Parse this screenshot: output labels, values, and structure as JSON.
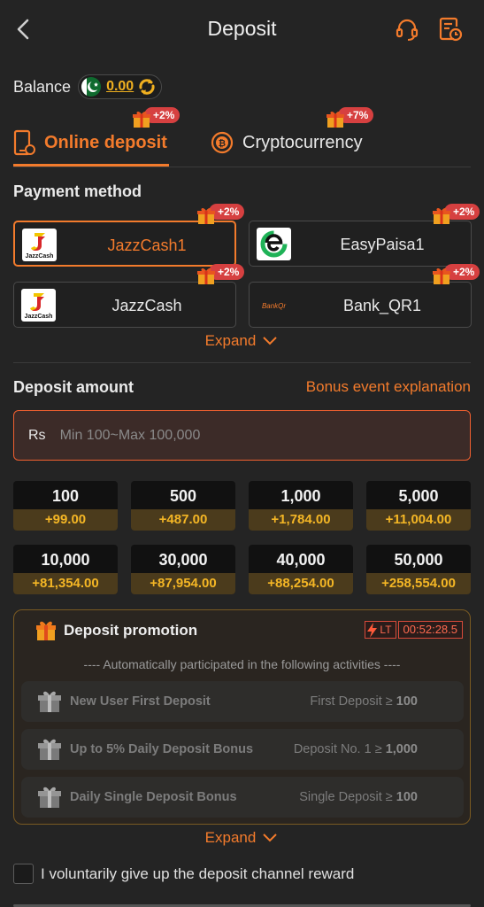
{
  "header": {
    "title": "Deposit",
    "back_icon": "chevron-left-icon",
    "support_icon": "headset-icon",
    "history_icon": "history-icon"
  },
  "balance": {
    "label": "Balance",
    "value": "0.00",
    "flag_icon": "pakistan-flag-icon",
    "refresh_icon": "refresh-icon"
  },
  "tabs": [
    {
      "label": "Online deposit",
      "badge": "+2%",
      "active": true
    },
    {
      "label": "Cryptocurrency",
      "badge": "+7%",
      "active": false
    }
  ],
  "payment": {
    "title": "Payment method",
    "methods": [
      {
        "name": "JazzCash1",
        "badge": "+2%",
        "logo": "JazzCash",
        "selected": true
      },
      {
        "name": "EasyPaisa1",
        "badge": "+2%",
        "logo": "",
        "selected": false
      },
      {
        "name": "JazzCash",
        "badge": "+2%",
        "logo": "JazzCash",
        "selected": false
      },
      {
        "name": "Bank_QR1",
        "badge": "+2%",
        "logo": "BankQr",
        "selected": false
      }
    ],
    "expand_label": "Expand"
  },
  "amount": {
    "title": "Deposit amount",
    "bonus_link": "Bonus event explanation",
    "currency": "Rs",
    "placeholder": "Min 100~Max 100,000",
    "chips": [
      {
        "value": "100",
        "bonus": "+99.00"
      },
      {
        "value": "500",
        "bonus": "+487.00"
      },
      {
        "value": "1,000",
        "bonus": "+1,784.00"
      },
      {
        "value": "5,000",
        "bonus": "+11,004.00"
      },
      {
        "value": "10,000",
        "bonus": "+81,354.00"
      },
      {
        "value": "30,000",
        "bonus": "+87,954.00"
      },
      {
        "value": "40,000",
        "bonus": "+88,254.00"
      },
      {
        "value": "50,000",
        "bonus": "+258,554.00"
      }
    ]
  },
  "promotion": {
    "title": "Deposit promotion",
    "timer_label": "LT",
    "timer": "00:52:28.5",
    "subtitle": "---- Automatically participated in the following activities ----",
    "activities": [
      {
        "name": "New User First Deposit",
        "condition": "First Deposit ≥",
        "amount": "100"
      },
      {
        "name": "Up to 5% Daily Deposit Bonus",
        "condition": "Deposit No. 1 ≥",
        "amount": "1,000"
      },
      {
        "name": "Daily Single Deposit Bonus",
        "condition": "Single Deposit ≥",
        "amount": "100"
      }
    ],
    "expand_label": "Expand"
  },
  "giveup": {
    "label": "I voluntarily give up the deposit channel reward",
    "checked": false
  },
  "colors": {
    "accent": "#f37b2c",
    "gold": "#f4b625",
    "badge": "#d64040",
    "background": "#242424"
  }
}
